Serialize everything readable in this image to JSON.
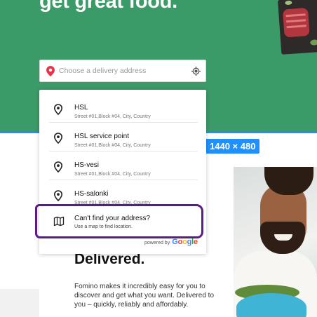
{
  "hero": {
    "title": "get great food."
  },
  "search": {
    "placeholder": "Choose a delivery address"
  },
  "results": [
    {
      "title": "HSL",
      "subtitle": "Street #01,Block #04, City, Country"
    },
    {
      "title": "HSL service point",
      "subtitle": "Street #01,Block #04, City, Country"
    },
    {
      "title": "HS-vesi",
      "subtitle": "Street #01,Block #04, City, Country"
    },
    {
      "title": "HS-salonki",
      "subtitle": "Street #01,Block #04, City, Country"
    }
  ],
  "fallback": {
    "title": "Can't find your address?",
    "subtitle": "Use a map to find location."
  },
  "powered": {
    "label": "powered by",
    "brand": "Google"
  },
  "overlay": {
    "dimensions": "1440 × 480"
  },
  "promo": {
    "heading": "Delivered.",
    "body": "Fomino makes it incredibly easy for you to discover and get what you want. Delivered to you – quickly, reliably and affordably."
  },
  "colors": {
    "hero_bg": "#3a9a68",
    "pin_red": "#e8334a",
    "guide_blue": "#1e90ff",
    "highlight_purple": "#5d1a8b",
    "google": [
      "#4285f4",
      "#ea4335",
      "#fbbc05",
      "#4285f4",
      "#34a853",
      "#ea4335"
    ]
  },
  "icons": {
    "search_pin": "map-pin-icon",
    "locate": "crosshair-icon",
    "result": "location-pin-icon",
    "fallback": "map-icon"
  }
}
